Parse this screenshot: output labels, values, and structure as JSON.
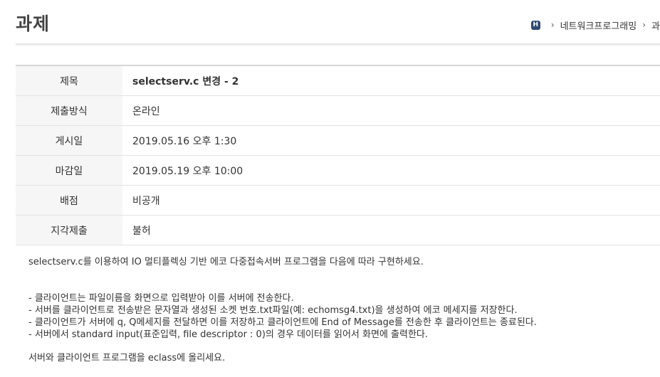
{
  "header": {
    "title": "과제",
    "breadcrumb": {
      "home_icon_label": "H",
      "items": [
        "네트워크프로그래밍",
        "과"
      ]
    }
  },
  "assignment": {
    "rows": [
      {
        "label": "제목",
        "value": "selectserv.c 변경 - 2"
      },
      {
        "label": "제출방식",
        "value": "온라인"
      },
      {
        "label": "게시일",
        "value": "2019.05.16 오후 1:30"
      },
      {
        "label": "마감일",
        "value": "2019.05.19 오후 10:00"
      },
      {
        "label": "배점",
        "value": "비공개"
      },
      {
        "label": "지각제출",
        "value": "불허"
      }
    ]
  },
  "body": {
    "intro": "selectserv.c를 이용하여 IO 멀티플렉싱 기반 에코 다중접속서버 프로그램을 다음에 따라  구현하세요.",
    "items": [
      "- 클라이언트는 파일이름을 화면으로 입력받아 이를 서버에 전송한다.",
      "- 서버를 클라이언트로 전송받은 문자열과 생성된 소켓 번호.txt파일(예: echomsg4.txt)을 생성하여 에코 메세지를 저장한다.",
      "- 클라이언트가 서버에 q, Q메세지를 전달하면 이를 저장하고 클라이언트에 End of Message를 전송한 후 클라이언트는 종료된다.",
      "- 서버에서   standard input(표준입력, file descriptor : 0)의 경우 데이터를 읽어서 화면에 출력한다."
    ],
    "footer": "서버와 클라이언트 프로그램을 eclass에 올리세요."
  }
}
